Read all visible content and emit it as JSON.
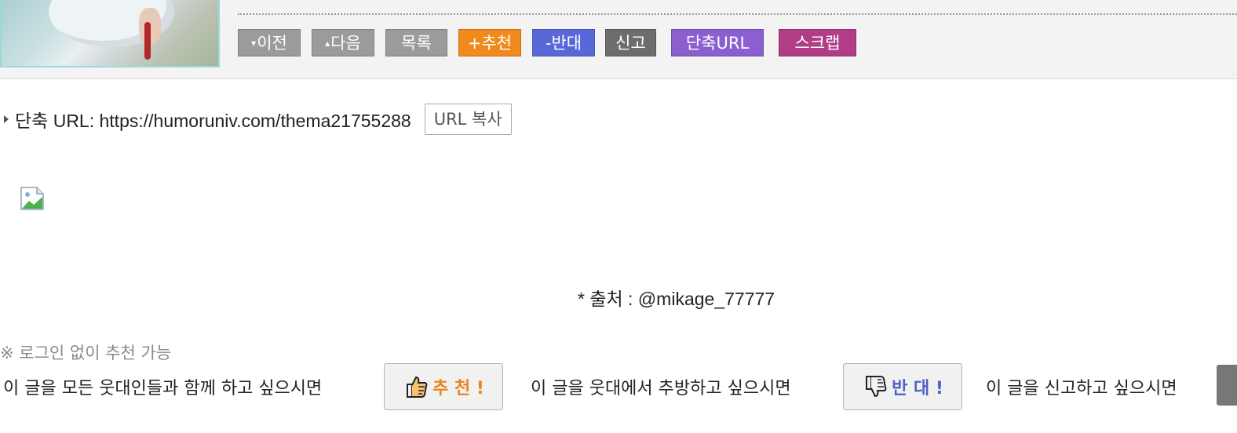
{
  "post_toolbar": {
    "buttons": [
      {
        "id": "prev",
        "arrow": "▾",
        "label": "이전",
        "color": "#9b9b9b"
      },
      {
        "id": "next",
        "arrow": "▴",
        "label": "다음",
        "color": "#9b9b9b"
      },
      {
        "id": "list",
        "arrow": "",
        "label": "목록",
        "color": "#9b9b9b"
      },
      {
        "id": "recommend",
        "arrow": "",
        "label": "+추천",
        "color": "#f18a1c"
      },
      {
        "id": "oppose",
        "arrow": "",
        "label": "-반대",
        "color": "#5968d9"
      },
      {
        "id": "report",
        "arrow": "",
        "label": "신고",
        "color": "#6d6d6d"
      },
      {
        "id": "short-url",
        "arrow": "",
        "label": "단축URL",
        "color": "#8b5fd0"
      },
      {
        "id": "scrap",
        "arrow": "",
        "label": "스크랩",
        "color": "#b13d86"
      }
    ]
  },
  "short_url": {
    "label": "단축 URL: https://humoruniv.com/thema21755288",
    "copy_button": "URL 복사"
  },
  "content": {
    "source": "* 출처 : @mikage_77777"
  },
  "voting": {
    "note": "※ 로그인 없이 추천 가능",
    "recommend_prompt": "이 글을 모든 웃대인들과 함께 하고 싶으시면",
    "recommend_button": "추 천 !",
    "oppose_prompt": "이 글을 웃대에서 추방하고 싶으시면",
    "oppose_button": "반 대 !",
    "report_prompt": "이 글을 신고하고 싶으시면"
  },
  "colors": {
    "recommend_accent": "#e8851c",
    "oppose_accent": "#4b62c8"
  }
}
